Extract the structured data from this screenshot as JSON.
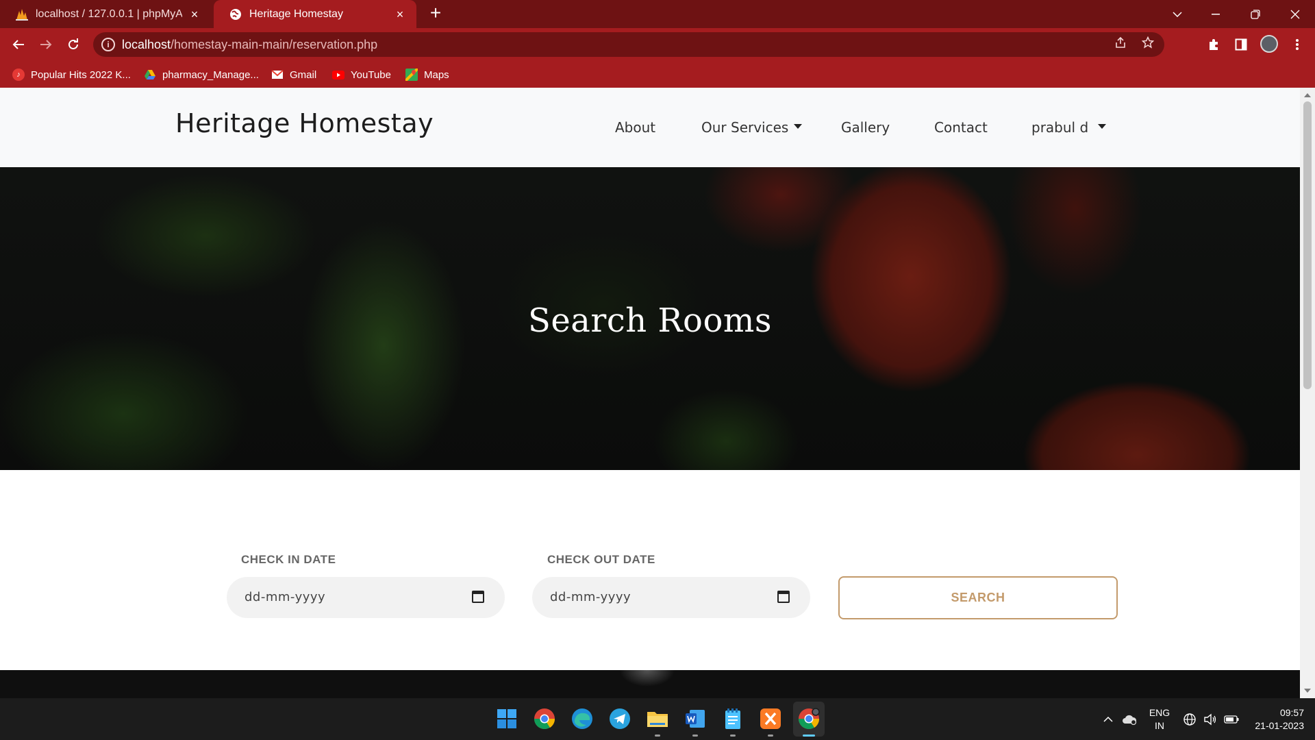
{
  "browser": {
    "tabs": [
      {
        "title": "localhost / 127.0.0.1 | phpMyAdmin",
        "favicon": "phpmyadmin-icon",
        "active": false
      },
      {
        "title": "Heritage Homestay",
        "favicon": "globe-icon",
        "active": true
      }
    ],
    "url_host": "localhost",
    "url_path": "/homestay-main-main/reservation.php",
    "bookmarks": [
      {
        "label": "Popular Hits 2022 K...",
        "icon": "music-icon"
      },
      {
        "label": "pharmacy_Manage...",
        "icon": "drive-icon"
      },
      {
        "label": "Gmail",
        "icon": "gmail-icon"
      },
      {
        "label": "YouTube",
        "icon": "youtube-icon"
      },
      {
        "label": "Maps",
        "icon": "maps-icon"
      }
    ],
    "colors": {
      "frame": "#6e1213",
      "toolbar": "#a51c1f"
    }
  },
  "site": {
    "brand": "Heritage Homestay",
    "nav": {
      "about": "About",
      "services": "Our Services",
      "gallery": "Gallery",
      "contact": "Contact",
      "user": "prabul d"
    },
    "hero_title": "Search Rooms",
    "form": {
      "checkin_label": "CHECK IN DATE",
      "checkin_placeholder": "dd-mm-yyyy",
      "checkout_label": "CHECK OUT DATE",
      "checkout_placeholder": "dd-mm-yyyy",
      "search_label": "SEARCH"
    },
    "colors": {
      "accent": "#c39a6b",
      "nav_bg": "#f8f9fa"
    }
  },
  "taskbar": {
    "apps": [
      "windows-start-icon",
      "chrome-icon",
      "edge-icon",
      "telegram-icon",
      "file-explorer-icon",
      "word-icon",
      "notepad-icon",
      "xampp-icon",
      "chrome-active-icon"
    ],
    "language": {
      "line1": "ENG",
      "line2": "IN"
    },
    "time": "09:57",
    "date": "21-01-2023"
  }
}
